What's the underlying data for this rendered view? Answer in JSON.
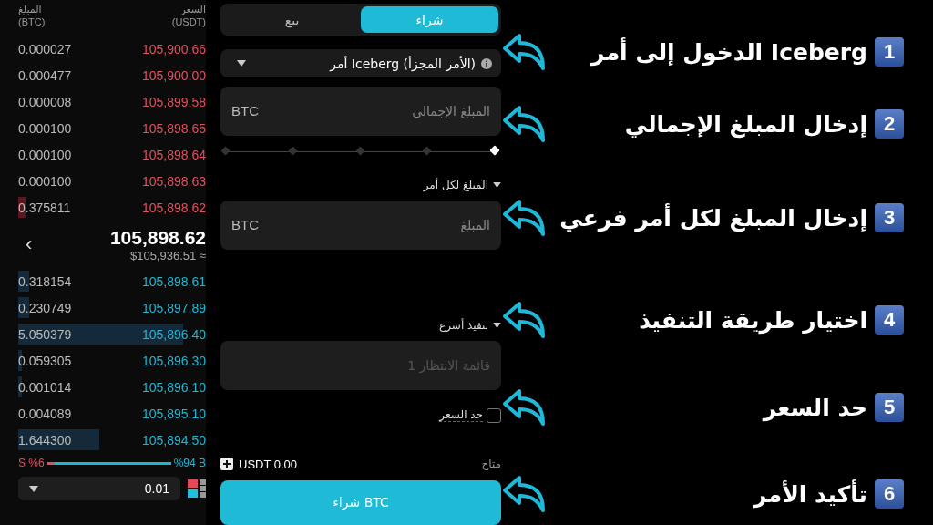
{
  "order_book": {
    "header": {
      "amount": "المبلغ",
      "amount_unit": "(BTC)",
      "price": "السعر",
      "price_unit": "(USDT)"
    },
    "asks": [
      {
        "amount": "0.000027",
        "price": "105,900.66"
      },
      {
        "amount": "0.000477",
        "price": "105,900.00"
      },
      {
        "amount": "0.000008",
        "price": "105,899.58"
      },
      {
        "amount": "0.000100",
        "price": "105,898.65"
      },
      {
        "amount": "0.000100",
        "price": "105,898.64"
      },
      {
        "amount": "0.000100",
        "price": "105,898.63"
      },
      {
        "amount": "0.375811",
        "price": "105,898.62"
      }
    ],
    "last_price": "105,898.62",
    "last_price_usd": "$105,936.51 ≈",
    "expand": "‹",
    "bids": [
      {
        "amount": "0.318154",
        "price": "105,898.61"
      },
      {
        "amount": "0.230749",
        "price": "105,897.89"
      },
      {
        "amount": "5.050379",
        "price": "105,896.40"
      },
      {
        "amount": "0.059305",
        "price": "105,896.30"
      },
      {
        "amount": "0.001014",
        "price": "105,896.10"
      },
      {
        "amount": "0.004089",
        "price": "105,895.10"
      },
      {
        "amount": "1.644300",
        "price": "105,894.50"
      }
    ],
    "ratio": {
      "sell_label": "S %6",
      "buy_label": "%94 B",
      "level": 0.06
    },
    "precision": "0.01"
  },
  "form": {
    "tabs": [
      {
        "label": "شراء",
        "selected": true
      },
      {
        "label": "بيع",
        "selected": false
      }
    ],
    "order_type": "أمر Iceberg (الأمر المجزأ)",
    "total_amount": {
      "placeholder": "المبلغ الإجمالي",
      "unit": "BTC"
    },
    "per_order_label": "المبلغ لكل أمر",
    "per_order": {
      "placeholder": "المبلغ",
      "unit": "BTC"
    },
    "execution_label": "تنفيذ أسرع",
    "queue": {
      "placeholder": "قائمة الانتظار 1"
    },
    "price_limit": {
      "label": "حد السعر",
      "checked": false
    },
    "available_label": "متاح",
    "available_value": "USDT 0.00",
    "submit": "شراء BTC"
  },
  "steps": [
    {
      "number": "1",
      "text": "الدخول إلى أمر Iceberg"
    },
    {
      "number": "2",
      "text": "إدخال المبلغ الإجمالي"
    },
    {
      "number": "3",
      "text": "إدخال المبلغ لكل أمر فرعي"
    },
    {
      "number": "4",
      "text": "اختيار طريقة التنفيذ"
    },
    {
      "number": "5",
      "text": "حد السعر"
    },
    {
      "number": "6",
      "text": "تأكيد الأمر"
    }
  ]
}
